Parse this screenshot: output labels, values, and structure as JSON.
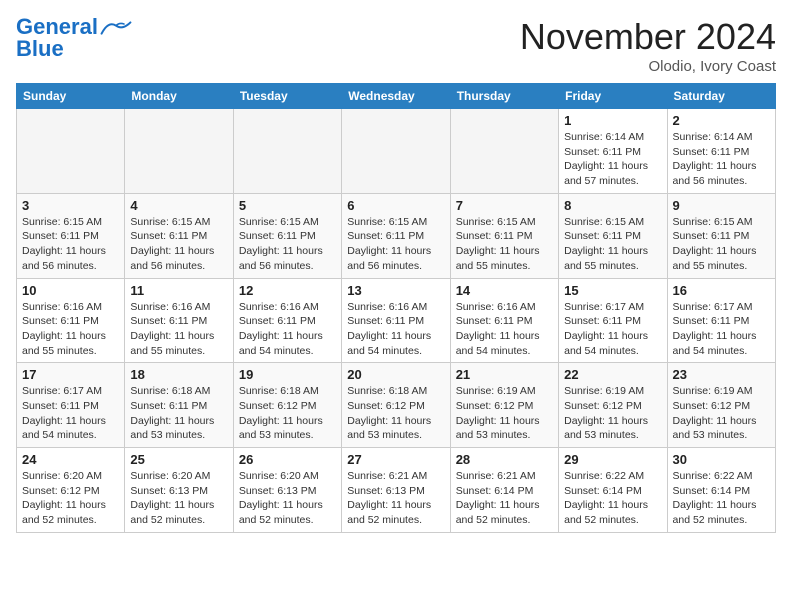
{
  "header": {
    "logo_line1": "General",
    "logo_line2": "Blue",
    "month": "November 2024",
    "location": "Olodio, Ivory Coast"
  },
  "weekdays": [
    "Sunday",
    "Monday",
    "Tuesday",
    "Wednesday",
    "Thursday",
    "Friday",
    "Saturday"
  ],
  "weeks": [
    [
      {
        "day": "",
        "empty": true
      },
      {
        "day": "",
        "empty": true
      },
      {
        "day": "",
        "empty": true
      },
      {
        "day": "",
        "empty": true
      },
      {
        "day": "",
        "empty": true
      },
      {
        "day": "1",
        "sunrise": "6:14 AM",
        "sunset": "6:11 PM",
        "daylight": "11 hours and 57 minutes."
      },
      {
        "day": "2",
        "sunrise": "6:14 AM",
        "sunset": "6:11 PM",
        "daylight": "11 hours and 56 minutes."
      }
    ],
    [
      {
        "day": "3",
        "sunrise": "6:15 AM",
        "sunset": "6:11 PM",
        "daylight": "11 hours and 56 minutes."
      },
      {
        "day": "4",
        "sunrise": "6:15 AM",
        "sunset": "6:11 PM",
        "daylight": "11 hours and 56 minutes."
      },
      {
        "day": "5",
        "sunrise": "6:15 AM",
        "sunset": "6:11 PM",
        "daylight": "11 hours and 56 minutes."
      },
      {
        "day": "6",
        "sunrise": "6:15 AM",
        "sunset": "6:11 PM",
        "daylight": "11 hours and 56 minutes."
      },
      {
        "day": "7",
        "sunrise": "6:15 AM",
        "sunset": "6:11 PM",
        "daylight": "11 hours and 55 minutes."
      },
      {
        "day": "8",
        "sunrise": "6:15 AM",
        "sunset": "6:11 PM",
        "daylight": "11 hours and 55 minutes."
      },
      {
        "day": "9",
        "sunrise": "6:15 AM",
        "sunset": "6:11 PM",
        "daylight": "11 hours and 55 minutes."
      }
    ],
    [
      {
        "day": "10",
        "sunrise": "6:16 AM",
        "sunset": "6:11 PM",
        "daylight": "11 hours and 55 minutes."
      },
      {
        "day": "11",
        "sunrise": "6:16 AM",
        "sunset": "6:11 PM",
        "daylight": "11 hours and 55 minutes."
      },
      {
        "day": "12",
        "sunrise": "6:16 AM",
        "sunset": "6:11 PM",
        "daylight": "11 hours and 54 minutes."
      },
      {
        "day": "13",
        "sunrise": "6:16 AM",
        "sunset": "6:11 PM",
        "daylight": "11 hours and 54 minutes."
      },
      {
        "day": "14",
        "sunrise": "6:16 AM",
        "sunset": "6:11 PM",
        "daylight": "11 hours and 54 minutes."
      },
      {
        "day": "15",
        "sunrise": "6:17 AM",
        "sunset": "6:11 PM",
        "daylight": "11 hours and 54 minutes."
      },
      {
        "day": "16",
        "sunrise": "6:17 AM",
        "sunset": "6:11 PM",
        "daylight": "11 hours and 54 minutes."
      }
    ],
    [
      {
        "day": "17",
        "sunrise": "6:17 AM",
        "sunset": "6:11 PM",
        "daylight": "11 hours and 54 minutes."
      },
      {
        "day": "18",
        "sunrise": "6:18 AM",
        "sunset": "6:11 PM",
        "daylight": "11 hours and 53 minutes."
      },
      {
        "day": "19",
        "sunrise": "6:18 AM",
        "sunset": "6:12 PM",
        "daylight": "11 hours and 53 minutes."
      },
      {
        "day": "20",
        "sunrise": "6:18 AM",
        "sunset": "6:12 PM",
        "daylight": "11 hours and 53 minutes."
      },
      {
        "day": "21",
        "sunrise": "6:19 AM",
        "sunset": "6:12 PM",
        "daylight": "11 hours and 53 minutes."
      },
      {
        "day": "22",
        "sunrise": "6:19 AM",
        "sunset": "6:12 PM",
        "daylight": "11 hours and 53 minutes."
      },
      {
        "day": "23",
        "sunrise": "6:19 AM",
        "sunset": "6:12 PM",
        "daylight": "11 hours and 53 minutes."
      }
    ],
    [
      {
        "day": "24",
        "sunrise": "6:20 AM",
        "sunset": "6:12 PM",
        "daylight": "11 hours and 52 minutes."
      },
      {
        "day": "25",
        "sunrise": "6:20 AM",
        "sunset": "6:13 PM",
        "daylight": "11 hours and 52 minutes."
      },
      {
        "day": "26",
        "sunrise": "6:20 AM",
        "sunset": "6:13 PM",
        "daylight": "11 hours and 52 minutes."
      },
      {
        "day": "27",
        "sunrise": "6:21 AM",
        "sunset": "6:13 PM",
        "daylight": "11 hours and 52 minutes."
      },
      {
        "day": "28",
        "sunrise": "6:21 AM",
        "sunset": "6:14 PM",
        "daylight": "11 hours and 52 minutes."
      },
      {
        "day": "29",
        "sunrise": "6:22 AM",
        "sunset": "6:14 PM",
        "daylight": "11 hours and 52 minutes."
      },
      {
        "day": "30",
        "sunrise": "6:22 AM",
        "sunset": "6:14 PM",
        "daylight": "11 hours and 52 minutes."
      }
    ]
  ]
}
